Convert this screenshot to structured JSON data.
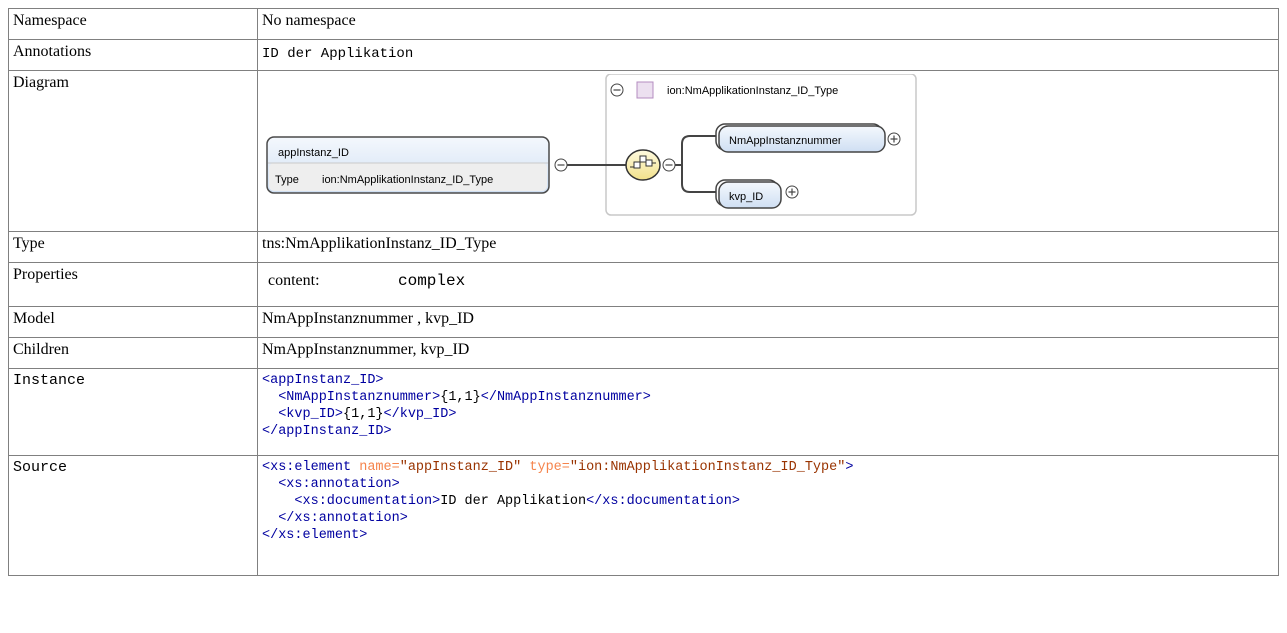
{
  "rows": {
    "namespace": {
      "label": "Namespace",
      "value": "No namespace"
    },
    "annotations": {
      "label": "Annotations",
      "value": "ID der Applikation"
    },
    "diagram": {
      "label": "Diagram",
      "element_name": "appInstanz_ID",
      "type_label": "Type",
      "type_value": "ion:NmApplikationInstanz_ID_Type",
      "complex_type_title": "ion:NmApplikationInstanz_ID_Type",
      "children": [
        "NmAppInstanznummer",
        "kvp_ID"
      ]
    },
    "type": {
      "label": "Type",
      "value": "tns:NmApplikationInstanz_ID_Type"
    },
    "properties": {
      "label": "Properties",
      "prop_name": "content:",
      "prop_value": "complex"
    },
    "model": {
      "label": "Model",
      "value": "NmAppInstanznummer , kvp_ID"
    },
    "children": {
      "label": "Children",
      "value": "NmAppInstanznummer, kvp_ID"
    },
    "instance": {
      "label": "Instance",
      "lines": [
        {
          "open": "<appInstanz_ID>"
        },
        {
          "open": "<NmAppInstanznummer>",
          "text": "{1,1}",
          "close": "</NmAppInstanznummer>"
        },
        {
          "open": "<kvp_ID>",
          "text": "{1,1}",
          "close": "</kvp_ID>"
        },
        {
          "open": "</appInstanz_ID>"
        }
      ]
    },
    "source": {
      "label": "Source",
      "line1_tag": "<xs:element",
      "line1_attr1": " name=",
      "line1_val1": "\"appInstanz_ID\"",
      "line1_attr2": " type=",
      "line1_val2": "\"ion:NmApplikationInstanz_ID_Type\"",
      "line1_end": ">",
      "line2": "<xs:annotation>",
      "line3_open": "<xs:documentation>",
      "line3_text": "ID der Applikation",
      "line3_close": "</xs:documentation>",
      "line4": "</xs:annotation>",
      "line5": "</xs:element>"
    }
  },
  "colors": {
    "tag": "#0000a0",
    "attribute": "#f5844c",
    "attribute_value": "#993300",
    "border": "#808080"
  }
}
